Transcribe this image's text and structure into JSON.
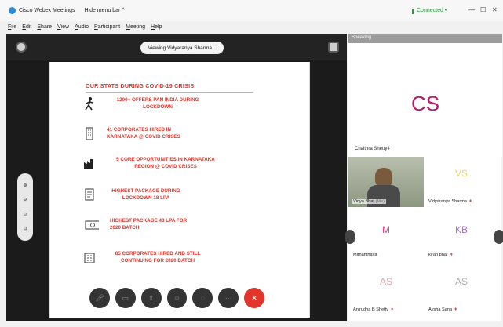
{
  "window": {
    "app_title": "Cisco Webex Meetings",
    "hide_menu": "Hide menu bar ^",
    "connection": "Connected •",
    "minimize": "—",
    "maximize": "☐",
    "close": "✕",
    "brand_color": "#2a8bd6"
  },
  "menu": {
    "items": [
      "File",
      "Edit",
      "Share",
      "View",
      "Audio",
      "Participant",
      "Meeting",
      "Help"
    ]
  },
  "stage": {
    "viewing_label": "Viewing Vidyaranya Sharma...",
    "slide": {
      "heading": "OUR STATS DURING COVID-19 CRISIS",
      "accent_color": "#d9362b",
      "items": [
        {
          "icon": "runner-icon",
          "text": "1200+ OFFERS PAN INDIA DURING LOCKDOWN"
        },
        {
          "icon": "building-icon",
          "text": "41 CORPORATES HIRED IN KARNATAKA @ COVID CRISES"
        },
        {
          "icon": "factory-icon",
          "text": "5 CORE OPPORTUNITIES IN KARNATAKA REGION @ COVID CRISES"
        },
        {
          "icon": "document-icon",
          "text": "HIGHEST PACKAGE DURING LOCKDOWN 18 LPA"
        },
        {
          "icon": "money-icon",
          "text": "HIGHEST PACKAGE 43 LPA FOR 2020 BATCH"
        },
        {
          "icon": "office-icon",
          "text": "85 CORPORATES HIRED AND STILL CONTINUING FOR 2020 BATCH"
        }
      ]
    }
  },
  "panel": {
    "speaking_label": "Speaking",
    "active_speaker": {
      "initials": "CS",
      "name": "Chaithra Shetty",
      "color": "#b51c6b"
    },
    "participants": [
      {
        "initials": "",
        "name": "Vidya Bhat",
        "sub": "(Me)",
        "video": true
      },
      {
        "initials": "VS",
        "name": "Vidyaranya Sharma",
        "color": "#e8d86a"
      },
      {
        "initials": "M",
        "name": "Mithanthaya",
        "color": "#d24a8a"
      },
      {
        "initials": "KB",
        "name": "kiran bhat",
        "color": "#b36bd6"
      },
      {
        "initials": "AS",
        "name": "Anirudha B Shetty",
        "color": "#e0a8b0"
      },
      {
        "initials": "AS",
        "name": "Aysha Sana",
        "color": "#b0b0b0"
      }
    ]
  }
}
